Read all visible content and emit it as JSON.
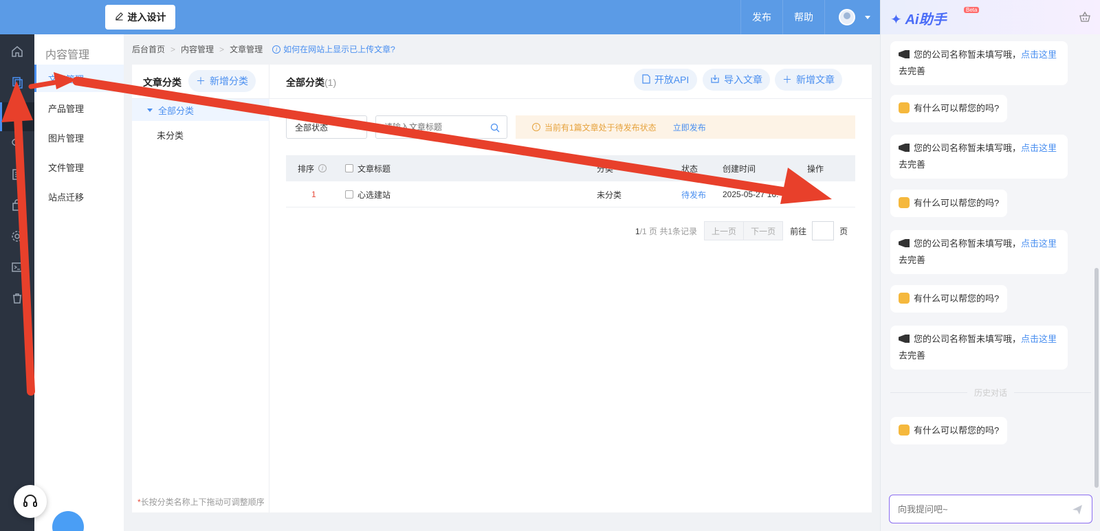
{
  "topbar": {
    "design_button": "进入设计",
    "publish": "发布",
    "help": "帮助"
  },
  "subnav": {
    "title": "内容管理",
    "items": [
      {
        "label": "文章管理",
        "active": true
      },
      {
        "label": "产品管理"
      },
      {
        "label": "图片管理"
      },
      {
        "label": "文件管理"
      },
      {
        "label": "站点迁移"
      }
    ]
  },
  "breadcrumb": {
    "items": [
      "后台首页",
      "内容管理",
      "文章管理"
    ],
    "help_link": "如何在网站上显示已上传文章?"
  },
  "categories": {
    "title": "文章分类",
    "add_button": "新增分类",
    "all": "全部分类",
    "sub": "未分类",
    "hint": "长按分类名称上下拖动可调整顺序"
  },
  "main": {
    "title": "全部分类",
    "count": "(1)",
    "open_api": "开放API",
    "import": "导入文章",
    "new_article": "新增文章",
    "status_select": "全部状态",
    "search_placeholder": "请输入文章标题",
    "notice": "当前有1篇文章处于待发布状态",
    "notice_action": "立即发布"
  },
  "table": {
    "headers": {
      "order": "排序",
      "title": "文章标题",
      "category": "分类",
      "status": "状态",
      "created": "创建时间",
      "actions": "操作"
    },
    "rows": [
      {
        "order": "1",
        "title": "心选建站",
        "category": "未分类",
        "status": "待发布",
        "created": "2025-05-27 16:"
      }
    ]
  },
  "pager": {
    "info_current": "1",
    "info_rest": "/1 页 共1条记录",
    "prev": "上一页",
    "next": "下一页",
    "goto": "前往",
    "page_suffix": "页"
  },
  "ai": {
    "title": "Ai助手",
    "beta": "Beta",
    "msg_company_a": "您的公司名称暂未填写哦，",
    "msg_company_link": "点击这里",
    "msg_company_b": "去完善",
    "msg_help": "有什么可以帮您的吗?",
    "history": "历史对话",
    "input_placeholder": "向我提问吧~"
  },
  "colors": {
    "topbar": "#5b9be6",
    "accent": "#4a8ff0",
    "arrow": "#e8402b"
  }
}
